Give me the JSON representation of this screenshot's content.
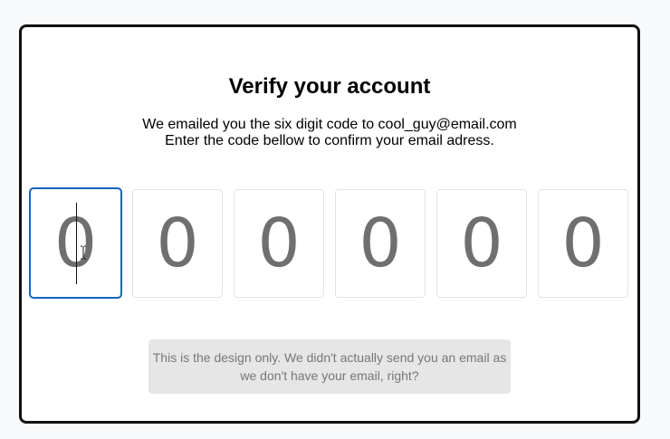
{
  "title": "Verify your account",
  "description": {
    "line1": "We emailed you the six digit code to cool_guy@email.com",
    "line2": "Enter the code bellow to confirm your email adress."
  },
  "code_digits": [
    "0",
    "0",
    "0",
    "0",
    "0",
    "0"
  ],
  "active_digit_index": 0,
  "note": {
    "line1": "This is the design only. We didn't actually send you an email as",
    "line2": "we don't have your email, right?"
  },
  "colors": {
    "focus_border": "#1565c0",
    "digit_text": "#6f6f6f",
    "note_background": "#e6e6e6"
  }
}
